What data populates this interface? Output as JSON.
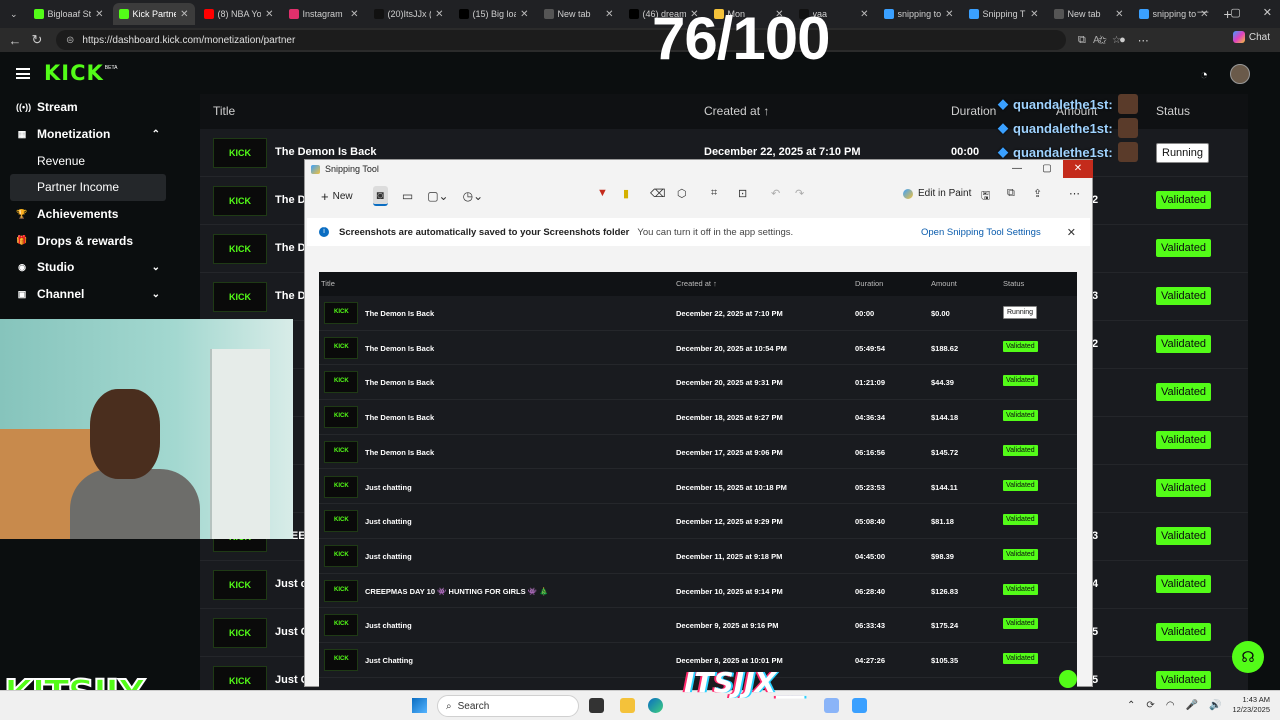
{
  "browser": {
    "tabs": [
      {
        "label": "Bigloaaf St",
        "color": "#53fc18",
        "active": false
      },
      {
        "label": "Kick Partner",
        "color": "#53fc18",
        "active": true
      },
      {
        "label": "(8) NBA You",
        "color": "#ff0000",
        "active": false
      },
      {
        "label": "Instagram",
        "color": "#e1306c",
        "active": false
      },
      {
        "label": "(20)ItsJJx (l",
        "color": "#111111",
        "active": false
      },
      {
        "label": "(15) Big loa",
        "color": "#000000",
        "active": false
      },
      {
        "label": "New tab",
        "color": "#555555",
        "active": false
      },
      {
        "label": "(46) dream",
        "color": "#000000",
        "active": false
      },
      {
        "label": "Mon",
        "color": "#f4c23a",
        "active": false
      },
      {
        "label": "yaa",
        "color": "#111111",
        "active": false
      },
      {
        "label": "snipping to",
        "color": "#3aa0ff",
        "active": false
      },
      {
        "label": "Snipping T",
        "color": "#3aa0ff",
        "active": false
      },
      {
        "label": "New tab",
        "color": "#555555",
        "active": false
      },
      {
        "label": "snipping to",
        "color": "#3aa0ff",
        "active": false
      }
    ],
    "url": "https://dashboard.kick.com/monetization/partner",
    "chat_label": "Chat"
  },
  "overlay": {
    "counter": "76/100",
    "chat": [
      {
        "user": "quandalethe1st:"
      },
      {
        "user": "quandalethe1st:"
      },
      {
        "user": "quandalethe1st:"
      }
    ]
  },
  "kick": {
    "logo": "KICK",
    "beta": "BETA",
    "sidebar": [
      {
        "label": "Stream",
        "icon": "((•))",
        "sub": false,
        "chev": ""
      },
      {
        "label": "Monetization",
        "icon": "▦",
        "sub": false,
        "chev": "⌃"
      },
      {
        "label": "Revenue",
        "icon": "",
        "sub": true,
        "chev": ""
      },
      {
        "label": "Partner Income",
        "icon": "",
        "sub": true,
        "chev": "",
        "selected": true
      },
      {
        "label": "Achievements",
        "icon": "🏆",
        "sub": false,
        "chev": ""
      },
      {
        "label": "Drops & rewards",
        "icon": "🎁",
        "sub": false,
        "chev": ""
      },
      {
        "label": "Studio",
        "icon": "◉",
        "sub": false,
        "chev": "⌄"
      },
      {
        "label": "Channel",
        "icon": "▣",
        "sub": false,
        "chev": "⌄"
      }
    ],
    "table_header": {
      "title": "Title",
      "created": "Created at ↑",
      "duration": "Duration",
      "amount": "Amount",
      "status": "Status"
    },
    "rows": [
      {
        "title": "The Demon Is Back",
        "created": "December 22, 2025 at 7:10 PM",
        "duration": "00:00",
        "amount": "$0.00",
        "status": "Running"
      },
      {
        "title": "The D",
        "status": "Validated",
        "tail": "2"
      },
      {
        "title": "The D",
        "status": "Validated",
        "tail": ""
      },
      {
        "title": "The D",
        "status": "Validated",
        "tail": "3"
      },
      {
        "title": "",
        "status": "Validated",
        "tail": "2"
      },
      {
        "title": "",
        "status": "Validated",
        "tail": ""
      },
      {
        "title": "",
        "status": "Validated",
        "tail": ""
      },
      {
        "title": "",
        "status": "Validated",
        "tail": ""
      },
      {
        "title": "CREE",
        "status": "Validated",
        "tail": "3"
      },
      {
        "title": "Just c",
        "status": "Validated",
        "tail": "4"
      },
      {
        "title": "Just C",
        "status": "Validated",
        "tail": "5"
      },
      {
        "title": "Just C",
        "status": "Validated",
        "tail": "5"
      }
    ]
  },
  "snipping": {
    "title": "Snipping Tool",
    "new_label": "New",
    "edit_in_paint": "Edit in Paint",
    "info_message": "Screenshots are automatically saved to your Screenshots folder",
    "info_sub": "You can turn it off in the app settings.",
    "info_link": "Open Snipping Tool Settings",
    "inner_header": {
      "title": "Title",
      "created": "Created at ↑",
      "duration": "Duration",
      "amount": "Amount",
      "status": "Status"
    },
    "inner_rows": [
      {
        "title": "The Demon Is Back",
        "created": "December 22, 2025 at 7:10 PM",
        "duration": "00:00",
        "amount": "$0.00",
        "status": "Running"
      },
      {
        "title": "The Demon Is Back",
        "created": "December 20, 2025 at 10:54 PM",
        "duration": "05:49:54",
        "amount": "$188.62",
        "status": "Validated"
      },
      {
        "title": "The Demon Is Back",
        "created": "December 20, 2025 at 9:31 PM",
        "duration": "01:21:09",
        "amount": "$44.39",
        "status": "Validated"
      },
      {
        "title": "The Demon Is Back",
        "created": "December 18, 2025 at 9:27 PM",
        "duration": "04:36:34",
        "amount": "$144.18",
        "status": "Validated"
      },
      {
        "title": "The Demon Is Back",
        "created": "December 17, 2025 at 9:06 PM",
        "duration": "06:16:56",
        "amount": "$145.72",
        "status": "Validated"
      },
      {
        "title": "Just chatting",
        "created": "December 15, 2025 at 10:18 PM",
        "duration": "05:23:53",
        "amount": "$144.11",
        "status": "Validated"
      },
      {
        "title": "Just chatting",
        "created": "December 12, 2025 at 9:29 PM",
        "duration": "05:08:40",
        "amount": "$81.18",
        "status": "Validated"
      },
      {
        "title": "Just chatting",
        "created": "December 11, 2025 at 9:18 PM",
        "duration": "04:45:00",
        "amount": "$98.39",
        "status": "Validated"
      },
      {
        "title": "CREEPMAS DAY 10 👾 HUNTING FOR GIRLS 👾 🎄",
        "created": "December 10, 2025 at 9:14 PM",
        "duration": "06:28:40",
        "amount": "$126.83",
        "status": "Validated"
      },
      {
        "title": "Just chatting",
        "created": "December 9, 2025 at 9:16 PM",
        "duration": "06:33:43",
        "amount": "$175.24",
        "status": "Validated"
      },
      {
        "title": "Just Chatting",
        "created": "December 8, 2025 at 10:01 PM",
        "duration": "04:27:26",
        "amount": "$105.35",
        "status": "Validated"
      }
    ]
  },
  "watermark": {
    "left": "KITSJJX",
    "tiktok": "ITSJJX__"
  },
  "taskbar": {
    "search_label": "Search",
    "time": "1:43 AM",
    "date": "12/23/2025"
  }
}
